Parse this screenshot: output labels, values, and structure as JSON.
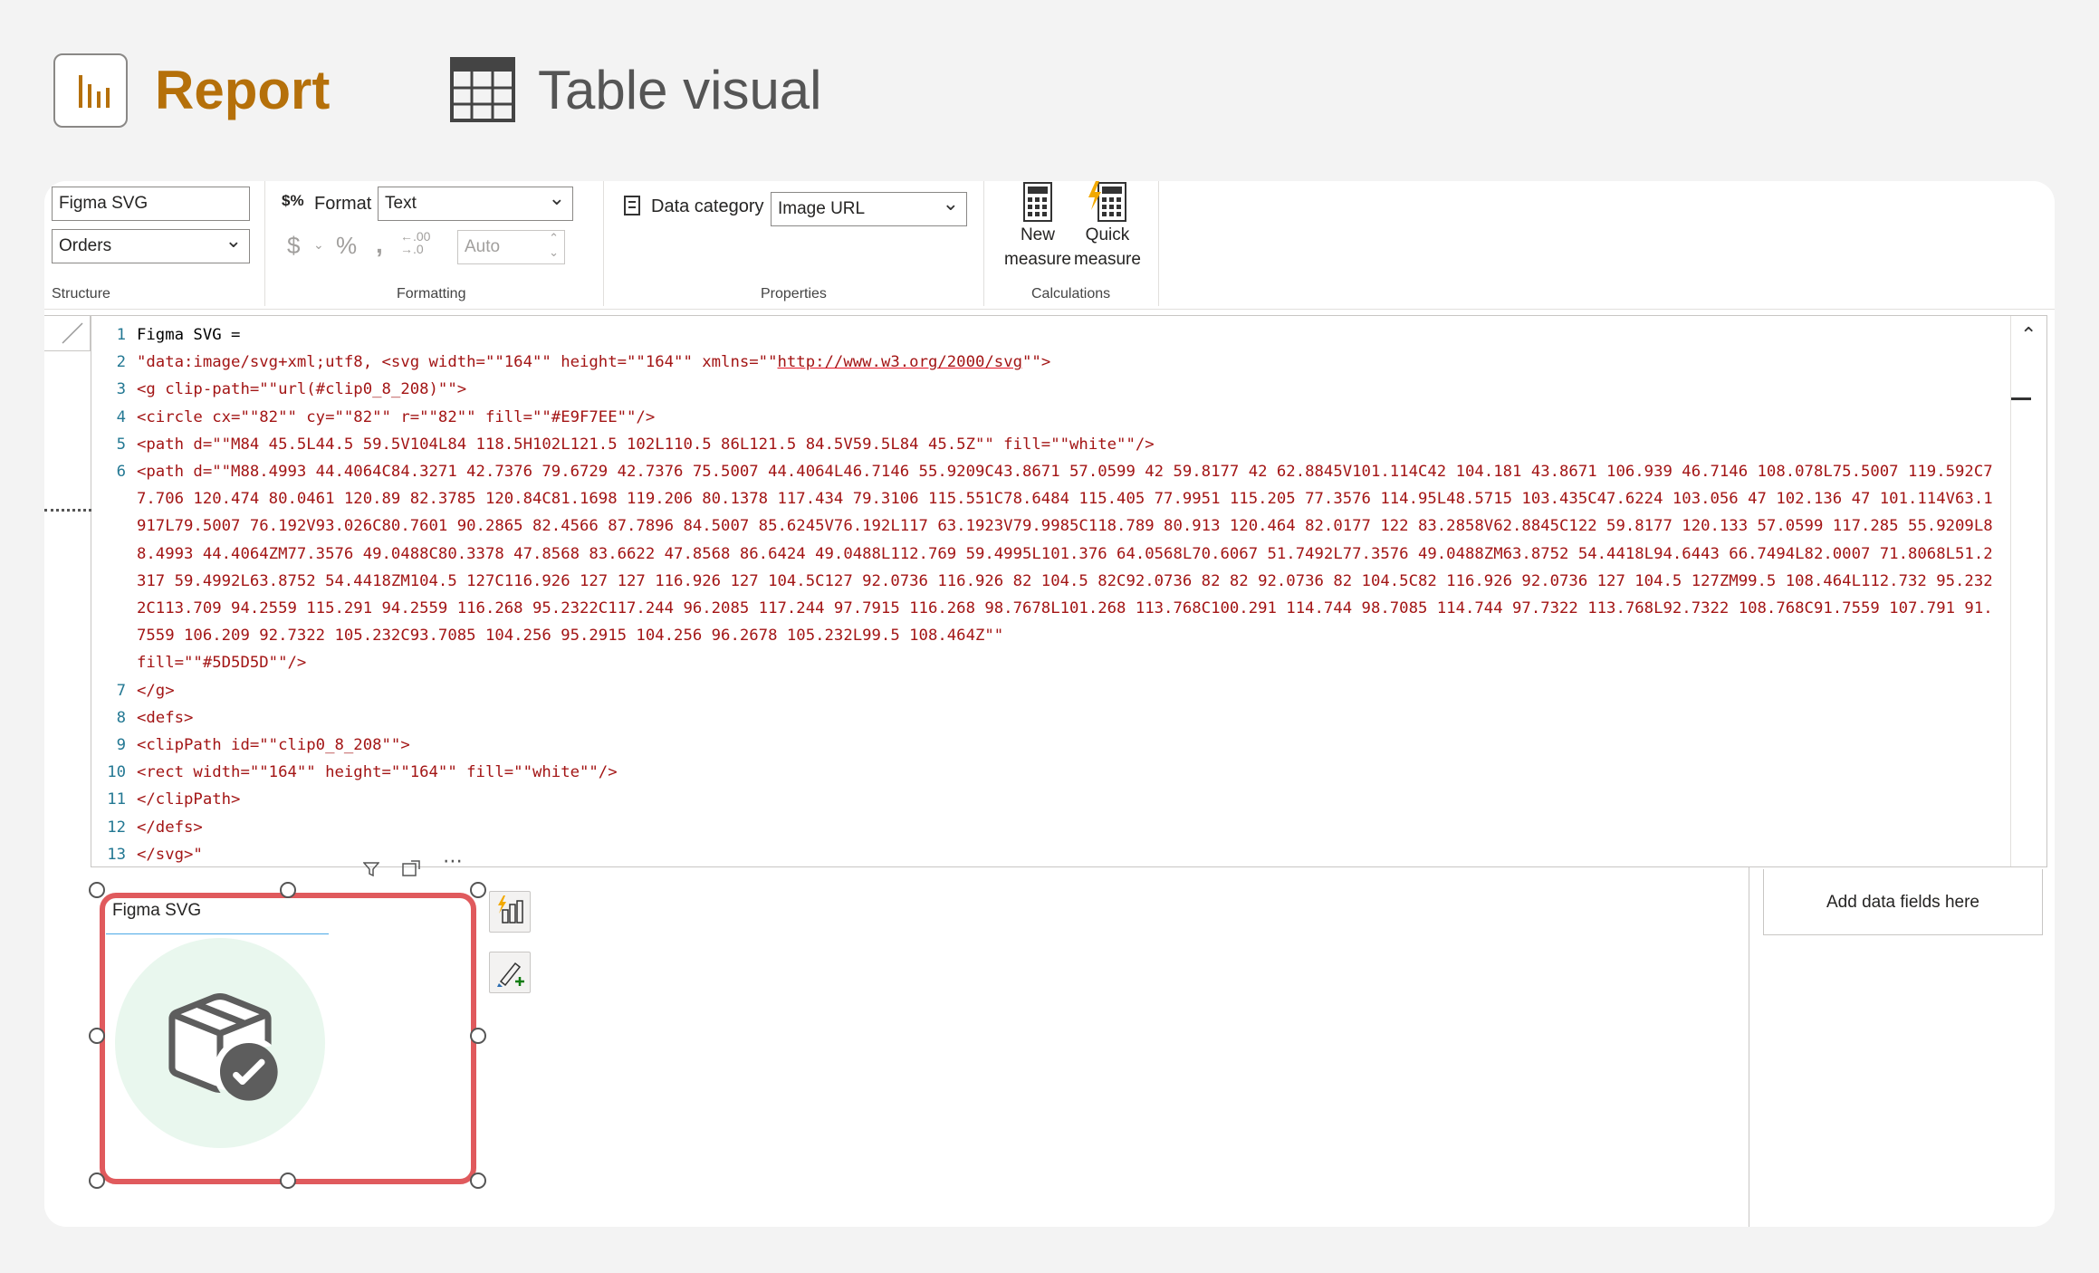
{
  "header": {
    "report_label": "Report",
    "table_visual_label": "Table visual"
  },
  "ribbon": {
    "structure": {
      "name_value": "Figma SVG",
      "table_value": "Orders",
      "group_label": "Structure"
    },
    "formatting": {
      "format_label": "Format",
      "format_value": "Text",
      "auto_value": "Auto",
      "group_label": "Formatting"
    },
    "properties": {
      "data_category_label": "Data category",
      "data_category_value": "Image URL",
      "group_label": "Properties"
    },
    "calculations": {
      "new_measure_line1": "New",
      "new_measure_line2": "measure",
      "quick_measure_line1": "Quick",
      "quick_measure_line2": "measure",
      "group_label": "Calculations"
    }
  },
  "editor": {
    "lines": [
      {
        "n": "1",
        "text": "Figma SVG ="
      },
      {
        "n": "2",
        "pre": "\"data:image/svg+xml;utf8, <svg width=\"\"164\"\" height=\"\"164\"\" xmlns=\"\"",
        "url": "http://www.w3.org/2000/svg",
        "post": "\"\">"
      },
      {
        "n": "3",
        "text": "<g clip-path=\"\"url(#clip0_8_208)\"\">"
      },
      {
        "n": "4",
        "text": "<circle cx=\"\"82\"\" cy=\"\"82\"\" r=\"\"82\"\" fill=\"\"#E9F7EE\"\"/>"
      },
      {
        "n": "5",
        "text": "<path d=\"\"M84 45.5L44.5 59.5V104L84 118.5H102L121.5 102L110.5 86L121.5 84.5V59.5L84 45.5Z\"\" fill=\"\"white\"\"/>"
      },
      {
        "n": "6",
        "text": "<path d=\"\"M88.4993 44.4064C84.3271 42.7376 79.6729 42.7376 75.5007 44.4064L46.7146 55.9209C43.8671 57.0599 42 59.8177 42 62.8845V101.114C42 104.181 43.8671 106.939 46.7146 108.078L75.5007 119.592C77.706 120.474 80.0461 120.89 82.3785 120.84C81.1698 119.206 80.1378 117.434 79.3106 115.551C78.6484 115.405 77.9951 115.205 77.3576 114.95L48.5715 103.435C47.6224 103.056 47 102.136 47 101.114V63.1917L79.5007 76.192V93.026C80.7601 90.2865 82.4566 87.7896 84.5007 85.6245V76.192L117 63.1923V79.9985C118.789 80.913 120.464 82.0177 122 83.2858V62.8845C122 59.8177 120.133 57.0599 117.285 55.9209L88.4993 44.4064ZM77.3576 49.0488C80.3378 47.8568 83.6622 47.8568 86.6424 49.0488L112.769 59.4995L101.376 64.0568L70.6067 51.7492L77.3576 49.0488ZM63.8752 54.4418L94.6443 66.7494L82.0007 71.8068L51.2317 59.4992L63.8752 54.4418ZM104.5 127C116.926 127 127 116.926 127 104.5C127 92.0736 116.926 82 104.5 82C92.0736 82 82 92.0736 82 104.5C82 116.926 92.0736 127 104.5 127ZM99.5 108.464L112.732 95.2322C113.709 94.2559 115.291 94.2559 116.268 95.2322C117.244 96.2085 117.244 97.7915 116.268 98.7678L101.268 113.768C100.291 114.744 98.7085 114.744 97.7322 113.768L92.7322 108.768C91.7559 107.791 91.7559 106.209 92.7322 105.232C93.7085 104.256 95.2915 104.256 96.2678 105.232L99.5 108.464Z\"\"\nfill=\"\"#5D5D5D\"\"/>"
      },
      {
        "n": "7",
        "text": "</g>"
      },
      {
        "n": "8",
        "text": "<defs>"
      },
      {
        "n": "9",
        "text": "<clipPath id=\"\"clip0_8_208\"\">"
      },
      {
        "n": "10",
        "text": "<rect width=\"\"164\"\" height=\"\"164\"\" fill=\"\"white\"\"/>"
      },
      {
        "n": "11",
        "text": "</clipPath>"
      },
      {
        "n": "12",
        "text": "</defs>"
      },
      {
        "n": "13",
        "text": "</svg>\""
      }
    ]
  },
  "visual": {
    "title": "Figma SVG",
    "icon": "package-check-icon",
    "circle_color": "#E9F7EE",
    "icon_color": "#5D5D5D"
  },
  "fields_pane": {
    "add_fields_label": "Add data fields here"
  },
  "colors": {
    "report_accent": "#b5700a",
    "selection_border": "#e05a5d",
    "string_color": "#a31515",
    "line_number_color": "#237893"
  }
}
